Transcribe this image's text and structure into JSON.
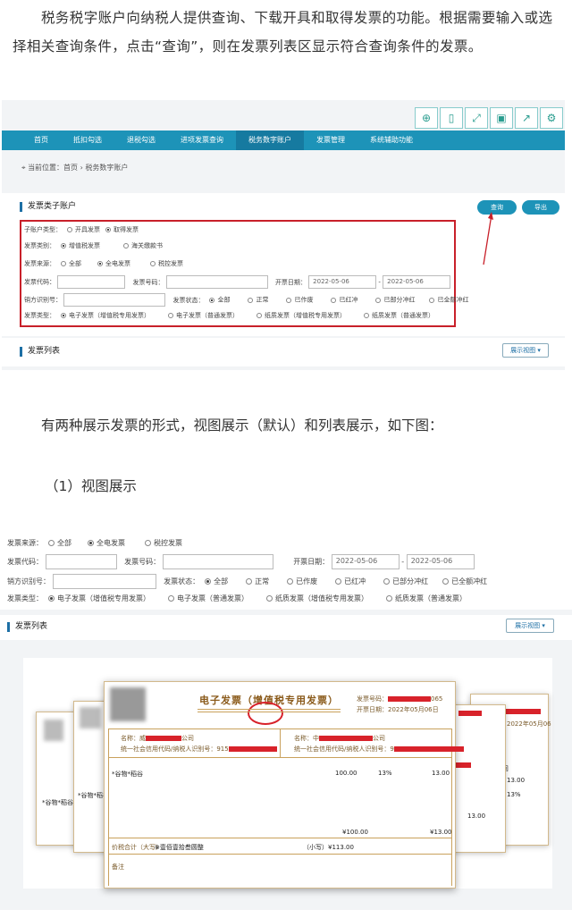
{
  "intro": "税务税字账户向纳税人提供查询、下载开具和取得发票的功能。根据需要输入或选择相关查询条件，点击“查询”，则在发票列表区显示符合查询条件的发票。",
  "para2": "有两种展示发票的形式，视图展示（默认）和列表展示，如下图：",
  "para3": "（1）视图展示",
  "toolbar_icons": [
    "search-icon",
    "phone-icon",
    "expand-icon",
    "save-icon",
    "share-icon",
    "gear-icon"
  ],
  "nav": [
    "首页",
    "抵扣勾选",
    "退税勾选",
    "进项发票查询",
    "税务数字账户",
    "发票管理",
    "系统辅助功能"
  ],
  "crumb": "当前位置：首页 › 税务数字账户",
  "section1": "发票类子账户",
  "btn_query": "查询",
  "btn_export": "导出",
  "form": {
    "acct_type": "子账户类型：",
    "acct_opts": [
      "开具发票",
      "取得发票"
    ],
    "cat": "发票类别：",
    "cat_opts": [
      "增值税发票",
      "海关缴款书"
    ],
    "src": "发票来源：",
    "src_opts": [
      "全部",
      "全电发票",
      "税控发票"
    ],
    "code": "发票代码：",
    "num": "发票号码：",
    "date": "开票日期：",
    "date_from": "2022-05-06",
    "date_to": "2022-05-06",
    "tax": "销方识别号：",
    "status": "发票状态：",
    "status_opts": [
      "全部",
      "正常",
      "已作废",
      "已红冲",
      "已部分冲红",
      "已全额冲红"
    ],
    "ftype": "发票类型：",
    "ftype_opts": [
      "电子发票（增值税专用发票）",
      "电子发票（普通发票）",
      "纸质发票（增值税专用发票）",
      "纸质发票（普通发票）"
    ]
  },
  "section2": "发票列表",
  "view_select": "展示视图",
  "invoice": {
    "title": "电子发票（增值税专用发票）",
    "no_label": "发票号码：",
    "no_tail": "065",
    "date_label": "开票日期：",
    "date": "2022年05月06日",
    "buyer_name": "名称：威",
    "buyer_suffix": "公司",
    "seller_name": "名称：中",
    "seller_suffix": "公司",
    "buyer_id": "统一社会信用代码/纳税人识别号：915",
    "seller_id": "统一社会信用代码/纳税人识别号：9",
    "item": "*谷物*稻谷",
    "amount": "100.00",
    "rate": "13%",
    "tax": "13.00",
    "sum_amount": "¥100.00",
    "sum_tax": "¥13.00",
    "total_label": "价税合计（大写）",
    "total_words": "⊗壹佰壹拾叁圆整",
    "total_small": "（小写）¥113.00",
    "note": "备注",
    "left_item": "*谷物*稻谷",
    "right_date": "2022年05月06",
    "right_rate": "13%",
    "right_tax": "13.00",
    "right_tax2": "13.00",
    "right_co": "公司"
  }
}
